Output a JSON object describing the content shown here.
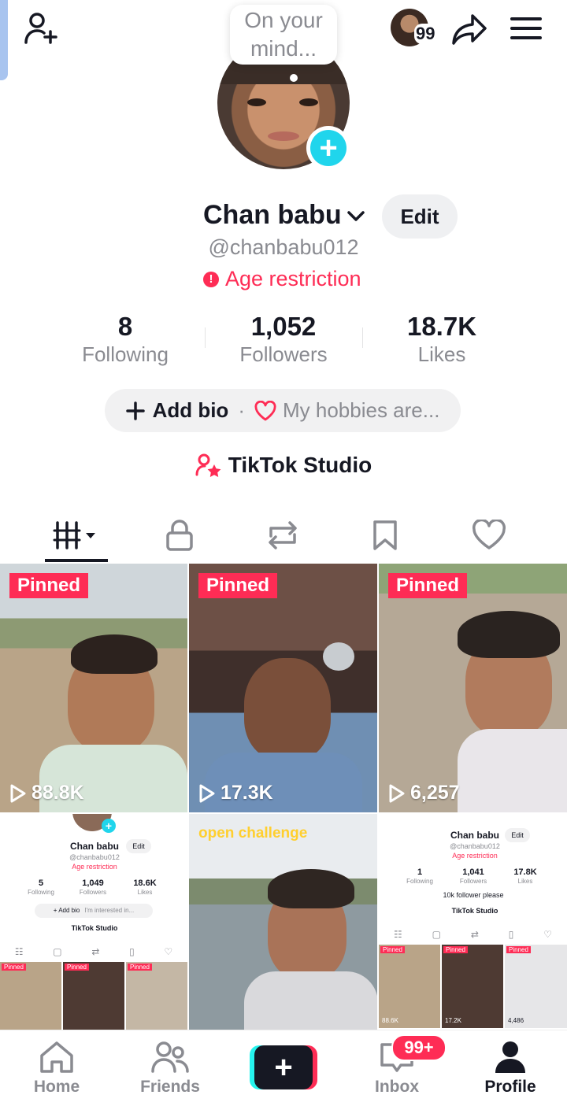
{
  "header": {
    "bubble_text": "On your mind...",
    "badge_count": "99"
  },
  "profile": {
    "name": "Chan babu",
    "edit_label": "Edit",
    "handle": "@chanbabu012",
    "age_restriction": "Age restriction",
    "stats": [
      {
        "value": "8",
        "label": "Following"
      },
      {
        "value": "1,052",
        "label": "Followers"
      },
      {
        "value": "18.7K",
        "label": "Likes"
      }
    ],
    "bio_add": "Add bio",
    "bio_separator": "·",
    "bio_hint": "My hobbies are...",
    "studio_label": "TikTok Studio"
  },
  "tabs": [
    "videos-tab",
    "private-tab",
    "reposts-tab",
    "favorites-tab",
    "liked-tab"
  ],
  "videos": [
    {
      "pinned": "Pinned",
      "views": "88.8K"
    },
    {
      "pinned": "Pinned",
      "views": "17.3K"
    },
    {
      "pinned": "Pinned",
      "views": "6,257"
    },
    {
      "overlay": "open challenge"
    }
  ],
  "mini_profile_1": {
    "name": "Chan babu",
    "edit": "Edit",
    "handle": "@chanbabu012",
    "age": "Age restriction",
    "stats": [
      {
        "value": "5",
        "label": "Following"
      },
      {
        "value": "1,049",
        "label": "Followers"
      },
      {
        "value": "18.6K",
        "label": "Likes"
      }
    ],
    "bio_add": "+ Add bio",
    "bio_hint": "I'm interested in...",
    "studio": "TikTok Studio",
    "pinned": [
      "Pinned",
      "Pinned",
      "Pinned"
    ]
  },
  "mini_profile_2": {
    "name": "Chan babu",
    "edit": "Edit",
    "handle": "@chanbabu012",
    "age": "Age restriction",
    "stats": [
      {
        "value": "1",
        "label": "Following"
      },
      {
        "value": "1,041",
        "label": "Followers"
      },
      {
        "value": "17.8K",
        "label": "Likes"
      }
    ],
    "bio_line": "10k follower please",
    "studio": "TikTok Studio",
    "pinned": [
      "Pinned",
      "Pinned",
      "Pinned"
    ],
    "views": [
      "88.6K",
      "17.2K",
      "4,486"
    ]
  },
  "nav": {
    "home": "Home",
    "friends": "Friends",
    "inbox": "Inbox",
    "inbox_badge": "99+",
    "profile": "Profile"
  },
  "colors": {
    "accent_red": "#fe2c55",
    "accent_cyan": "#25f4ee",
    "avatar_add": "#20d5ec",
    "text_primary": "#161823",
    "text_secondary": "#8a8b91"
  }
}
